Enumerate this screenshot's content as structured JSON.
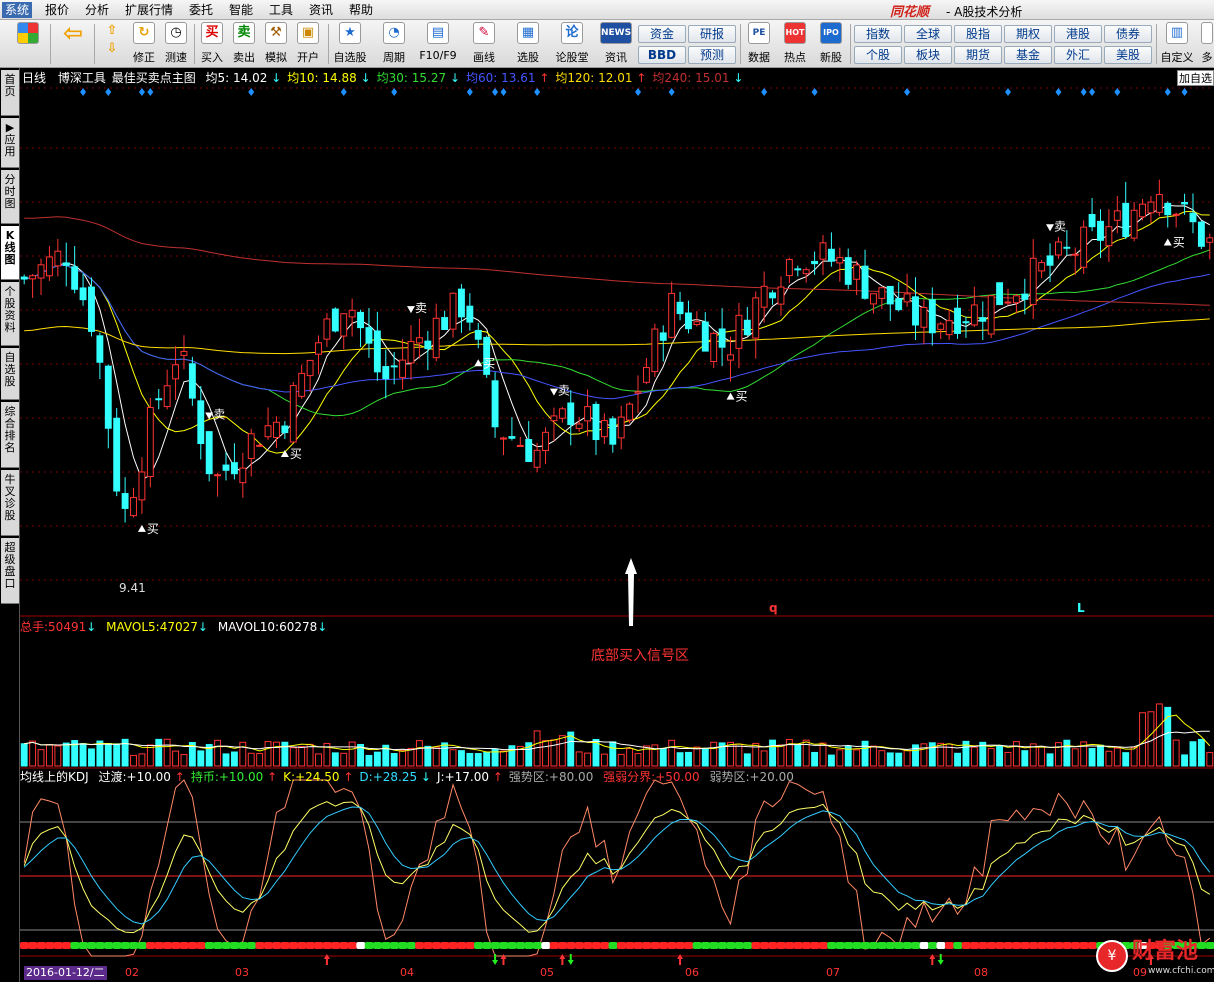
{
  "menubar": {
    "items": [
      "系统",
      "报价",
      "分析",
      "扩展行情",
      "委托",
      "智能",
      "工具",
      "资讯",
      "帮助"
    ],
    "brand": "同花顺",
    "app_title": "- A股技术分析"
  },
  "toolbar": {
    "buttons": [
      {
        "label": "",
        "icon": "grid-icon"
      },
      {
        "label": "",
        "icon": "back-arrow-icon"
      },
      {
        "label": "修正",
        "icon": "revise-icon"
      },
      {
        "label": "测速",
        "icon": "speedtest-icon"
      },
      {
        "label": "买入",
        "icon": "buy-icon"
      },
      {
        "label": "卖出",
        "icon": "sell-icon"
      },
      {
        "label": "模拟",
        "icon": "gavel-icon"
      },
      {
        "label": "开户",
        "icon": "lock-icon"
      },
      {
        "label": "自选股",
        "icon": "star-icon"
      },
      {
        "label": "周期",
        "icon": "clock-icon"
      },
      {
        "label": "F10/F9",
        "icon": "f10-icon"
      },
      {
        "label": "画线",
        "icon": "pen-icon"
      },
      {
        "label": "选股",
        "icon": "filter-icon"
      },
      {
        "label": "论股堂",
        "icon": "forum-icon"
      },
      {
        "label": "资讯",
        "icon": "news-icon"
      },
      {
        "label": "数据",
        "icon": "pe-icon"
      },
      {
        "label": "热点",
        "icon": "hot-icon"
      },
      {
        "label": "新股",
        "icon": "ipo-icon"
      },
      {
        "label": "自定义",
        "icon": "custom-icon"
      },
      {
        "label": "多",
        "icon": "more-icon"
      }
    ],
    "icon_text": {
      "buy": "买",
      "sell": "卖",
      "news": "NEWS",
      "pe": "PE",
      "hot": "HOT",
      "ipo": "IPO",
      "forum": "论"
    },
    "small_buttons": [
      "资金",
      "研报",
      "BBD",
      "预测"
    ],
    "grid_buttons": [
      "指数",
      "全球",
      "股指",
      "期权",
      "港股",
      "债券",
      "个股",
      "板块",
      "期货",
      "基金",
      "外汇",
      "美股"
    ]
  },
  "sidebar": {
    "tabs": [
      "首页",
      "应用",
      "分时图",
      "K线图",
      "个股资料",
      "自选股",
      "综合排名",
      "牛叉诊股",
      "超级盘口"
    ]
  },
  "main_legend": {
    "period": "日线",
    "tool": "博深工具",
    "indicator": "最佳买卖点主图",
    "ma": [
      {
        "label": "均5:",
        "value": "14.02",
        "arrow": "↓",
        "color": "#ffffff"
      },
      {
        "label": "均10:",
        "value": "14.88",
        "arrow": "↓",
        "color": "#ffff00"
      },
      {
        "label": "均30:",
        "value": "15.27",
        "arrow": "↓",
        "color": "#33dd33"
      },
      {
        "label": "均60:",
        "value": "13.61",
        "arrow": "↑",
        "color": "#4455ff"
      },
      {
        "label": "均120:",
        "value": "12.01",
        "arrow": "↑",
        "color": "#ffdd00"
      },
      {
        "label": "均240:",
        "value": "15.01",
        "arrow": "↓",
        "color": "#c03030"
      }
    ],
    "add_watch": "加自选"
  },
  "price_chart": {
    "annotations": {
      "low_value": "9.41",
      "buy": "买",
      "sell": "卖",
      "signal_text": "底部买入信号区",
      "letter_q": "q",
      "letter_L": "L"
    },
    "signals": [
      {
        "type": "buy",
        "bar": 14
      },
      {
        "type": "sell",
        "bar": 22
      },
      {
        "type": "buy",
        "bar": 31
      },
      {
        "type": "sell",
        "bar": 46
      },
      {
        "type": "buy",
        "bar": 54
      },
      {
        "type": "sell",
        "bar": 63
      },
      {
        "type": "buy",
        "bar": 84
      },
      {
        "type": "sell",
        "bar": 122
      },
      {
        "type": "buy",
        "bar": 136
      }
    ]
  },
  "volume_legend": {
    "total_label": "总手:",
    "total_value": "50491",
    "total_arrow": "↓",
    "mavol5_label": "MAVOL5:",
    "mavol5_value": "47027",
    "mavol5_arrow": "↓",
    "mavol10_label": "MAVOL10:",
    "mavol10_value": "60278",
    "mavol10_arrow": "↓"
  },
  "kdj_legend": {
    "title": "均线上的KDJ",
    "items": [
      {
        "label": "过渡:",
        "value": "+10.00",
        "arrow": "↑",
        "color": "#ffffff"
      },
      {
        "label": "持币:",
        "value": "+10.00",
        "arrow": "↑",
        "color": "#33ee33"
      },
      {
        "label": "K:",
        "value": "+24.50",
        "arrow": "↑",
        "color": "#ffff00"
      },
      {
        "label": "D:",
        "value": "+28.25",
        "arrow": "↓",
        "color": "#33ddff"
      },
      {
        "label": "J:",
        "value": "+17.00",
        "arrow": "↑",
        "color": "#ffffff"
      },
      {
        "label": "强势区:",
        "value": "+80.00",
        "arrow": "",
        "color": "#aaaaaa"
      },
      {
        "label": "强弱分界:",
        "value": "+50.00",
        "arrow": "",
        "color": "#ff3333"
      },
      {
        "label": "弱势区:",
        "value": "+20.00",
        "arrow": "",
        "color": "#aaaaaa"
      }
    ]
  },
  "time_axis": {
    "start_date": "2016-01-12/二",
    "months": [
      "02",
      "03",
      "04",
      "05",
      "06",
      "07",
      "08",
      "09"
    ]
  },
  "watermark": {
    "text": "财富池",
    "url": "www.cfchi.com"
  },
  "colors": {
    "up": "#ff3333",
    "down": "#33ffff",
    "grid": "#8a0000"
  }
}
